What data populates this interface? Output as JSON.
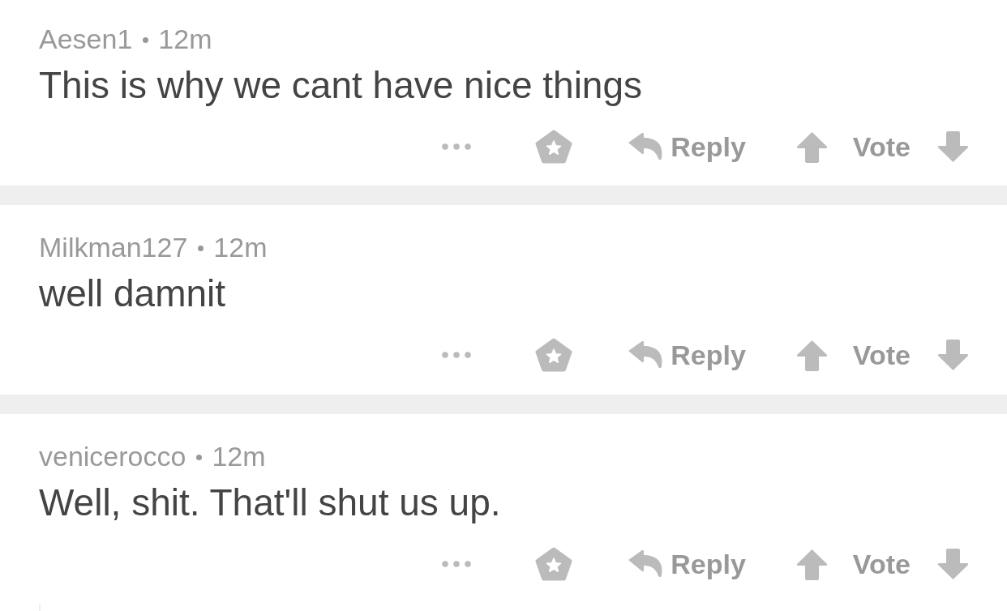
{
  "comments": [
    {
      "author": "Aesen1",
      "time": "12m",
      "body": "This is why we cant have nice things",
      "reply": "Reply",
      "vote": "Vote"
    },
    {
      "author": "Milkman127",
      "time": "12m",
      "body": "well damnit",
      "reply": "Reply",
      "vote": "Vote"
    },
    {
      "author": "venicerocco",
      "time": "12m",
      "body": "Well, shit. That'll shut us up.",
      "reply": "Reply",
      "vote": "Vote"
    }
  ]
}
